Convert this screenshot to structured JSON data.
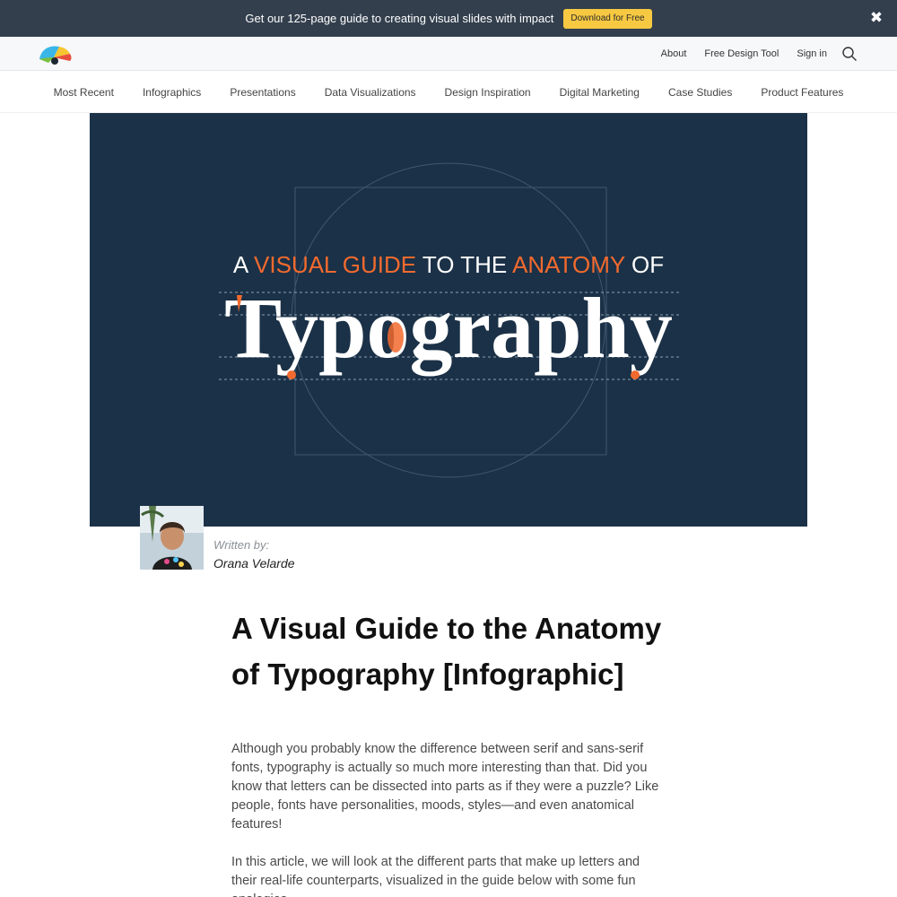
{
  "promo": {
    "text": "Get our 125-page guide to creating visual slides with impact",
    "button_label": "Download for Free",
    "close_glyph": "✖"
  },
  "header": {
    "links": [
      "About",
      "Free Design Tool",
      "Sign in"
    ]
  },
  "categories": [
    "Most Recent",
    "Infographics",
    "Presentations",
    "Data Visualizations",
    "Design Inspiration",
    "Digital Marketing",
    "Case Studies",
    "Product Features"
  ],
  "hero": {
    "line1": {
      "a": "A ",
      "visual_guide": "VISUAL GUIDE",
      "to_the": " TO THE ",
      "anatomy": "ANATOMY",
      "of": " OF"
    },
    "headline": "Typography",
    "colors": {
      "background": "#1b3147",
      "accent": "#f26a2e",
      "text": "#ffffff"
    }
  },
  "author": {
    "label": "Written by:",
    "name": "Orana Velarde"
  },
  "article": {
    "title": "A Visual Guide to the Anatomy of Typography [Infographic]",
    "paragraphs": [
      "Although you probably know the difference between serif and sans-serif fonts, typography is actually so much more interesting than that. Did you know that letters can be dissected into parts as if they were a puzzle? Like people, fonts have personalities, moods, styles—and even anatomical features!",
      "In this article, we will look at the different parts that make up letters and their real-life counterparts, visualized in the guide below with some fun analogies."
    ]
  },
  "icons": {
    "logo": "venngage-logo-icon",
    "search": "search-icon",
    "close": "close-icon"
  }
}
